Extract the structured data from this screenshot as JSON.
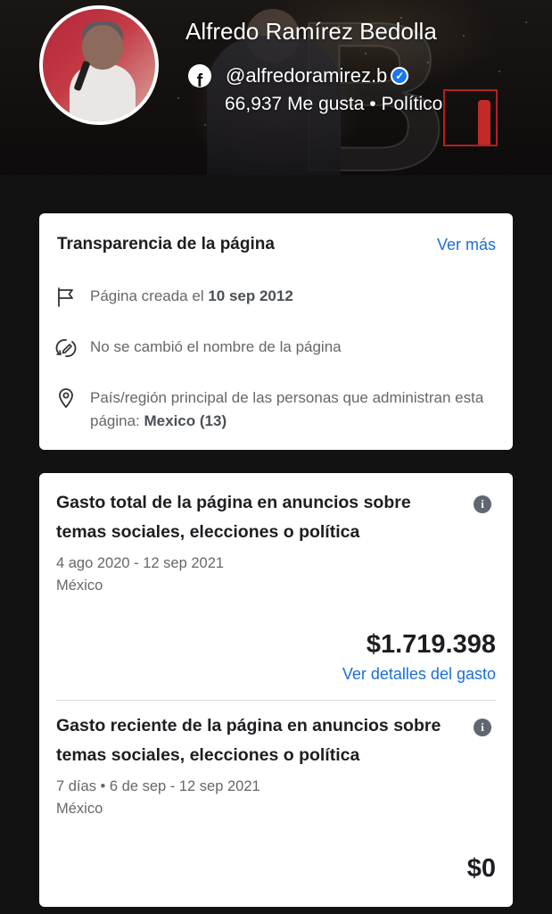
{
  "header": {
    "page_name": "Alfredo Ramírez Bedolla",
    "handle": "@alfredoramirez.b",
    "stats": "66,937 Me gusta • Político",
    "fb_letter": "f",
    "verified_mark": "✓"
  },
  "transparency": {
    "title": "Transparencia de la página",
    "see_more": "Ver más",
    "created_label": "Página creada el",
    "created_date": "10 sep 2012",
    "name_changes": "No se cambió el nombre de la página",
    "admin_location_label": "País/región principal de las personas que administran esta página:",
    "admin_location_value": "Mexico (13)"
  },
  "spend_total": {
    "title": "Gasto total de la página en anuncios sobre temas sociales, elecciones o política",
    "date_range": "4 ago 2020 - 12 sep 2021",
    "country": "México",
    "amount": "$1.719.398",
    "details_link": "Ver detalles del gasto"
  },
  "spend_recent": {
    "title": "Gasto reciente de la página en anuncios sobre temas sociales, elecciones o política",
    "date_range": "7 días • 6 de sep - 12 sep 2021",
    "country": "México",
    "amount": "$0"
  },
  "icons": {
    "info": "i",
    "facebook": "facebook-icon",
    "flag": "flag-icon",
    "rename": "rename-icon",
    "location": "location-pin-icon"
  },
  "colors": {
    "background": "#121212",
    "card": "#ffffff",
    "link": "#1a6ed8",
    "verified": "#1877f2"
  }
}
